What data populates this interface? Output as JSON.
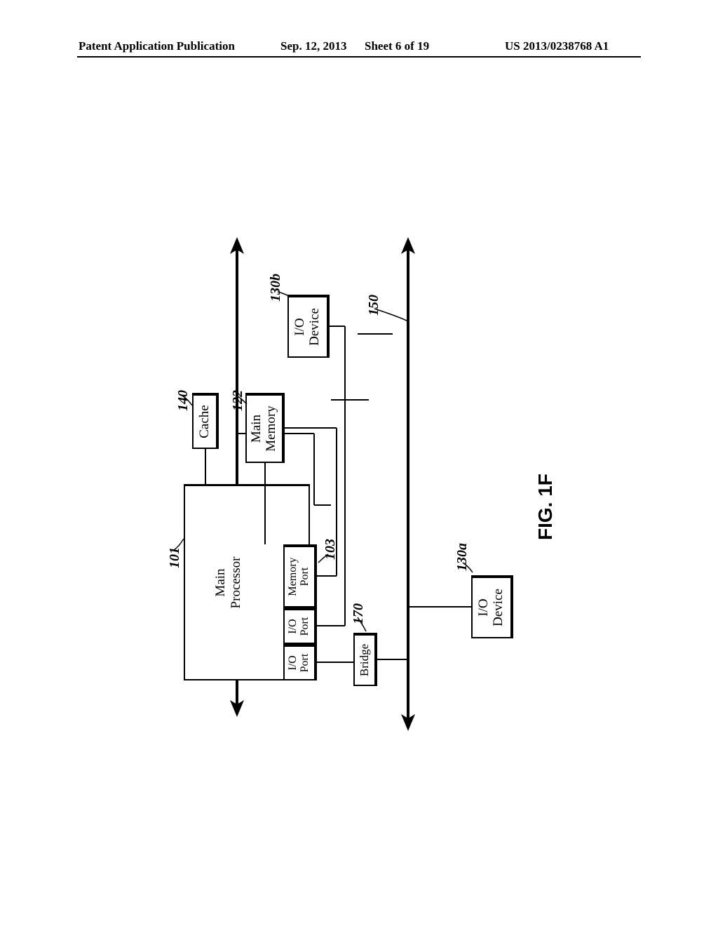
{
  "header": {
    "pub_type": "Patent Application Publication",
    "date": "Sep. 12, 2013",
    "sheet": "Sheet 6 of 19",
    "pub_number": "US 2013/0238768 A1"
  },
  "diagram": {
    "figure_label": "FIG. 1F",
    "components": {
      "main_processor": {
        "label": "Main\nProcessor",
        "ref": "101"
      },
      "io_port_1": {
        "line1": "I/O",
        "line2": "Port"
      },
      "io_port_2": {
        "line1": "I/O",
        "line2": "Port"
      },
      "memory_port": {
        "line1": "Memory",
        "line2": "Port",
        "ref": "103"
      },
      "cache": {
        "label": "Cache",
        "ref": "140"
      },
      "main_memory": {
        "label": "Main\nMemory",
        "ref": "122"
      },
      "bridge": {
        "label": "Bridge",
        "ref": "170"
      },
      "io_device_a": {
        "label": "I/O\nDevice",
        "ref": "130a"
      },
      "io_device_b": {
        "label": "I/O\nDevice",
        "ref": "130b"
      },
      "bus": {
        "ref": "150"
      }
    }
  }
}
